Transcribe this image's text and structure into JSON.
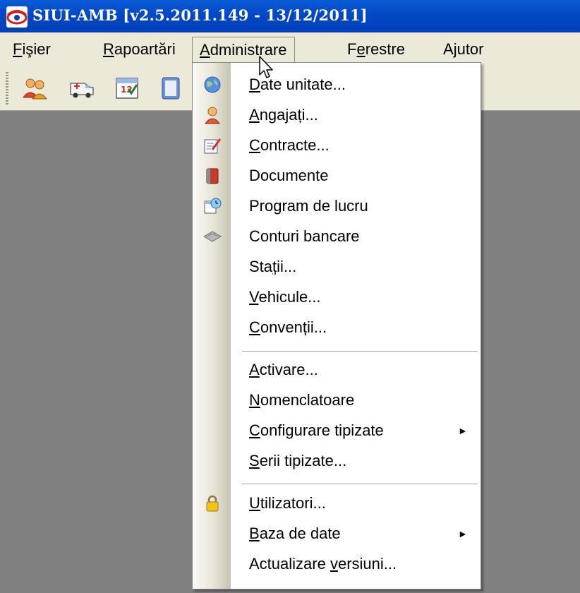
{
  "window": {
    "title": "SIUI-AMB [v2.5.2011.149 - 13/12/2011]",
    "colors": {
      "titlebar": "#0248c4",
      "workspace": "#808080",
      "menubar": "#ece9d8"
    }
  },
  "menubar": {
    "items": [
      {
        "pre": "",
        "key": "F",
        "post": "işier"
      },
      {
        "pre": "",
        "key": "R",
        "post": "apoartări"
      },
      {
        "pre": "",
        "key": "A",
        "post": "dministrare"
      },
      {
        "pre": "F",
        "key": "e",
        "post": "restre"
      },
      {
        "pre": "A",
        "key": "j",
        "post": "utor"
      }
    ]
  },
  "toolbar": {
    "buttons": [
      "users-icon",
      "ambulance-icon",
      "calendar-icon",
      "document-icon"
    ]
  },
  "dropdown": {
    "items": [
      {
        "pre": "",
        "key": "D",
        "post": "ate unitate...",
        "icon": "globe-icon"
      },
      {
        "pre": "",
        "key": "A",
        "post": "ngajați...",
        "icon": "person-icon"
      },
      {
        "pre": "",
        "key": "C",
        "post": "ontracte...",
        "icon": "contract-pen-icon"
      },
      {
        "pre": "Documente",
        "key": "",
        "post": "",
        "icon": "book-icon"
      },
      {
        "pre": "Program de lucru",
        "key": "",
        "post": "",
        "icon": "schedule-icon"
      },
      {
        "pre": "Conturi bancare",
        "key": "",
        "post": "",
        "icon": "card-icon"
      },
      {
        "pre": "Sta",
        "key": "ț",
        "post": "ii...",
        "icon": ""
      },
      {
        "pre": "",
        "key": "V",
        "post": "ehicule...",
        "icon": ""
      },
      {
        "pre": "",
        "key": "C",
        "post": "onvenții...",
        "icon": ""
      },
      {
        "pre": "",
        "key": "A",
        "post": "ctivare...",
        "icon": ""
      },
      {
        "pre": "",
        "key": "N",
        "post": "omenclatoare",
        "icon": ""
      },
      {
        "pre": "",
        "key": "C",
        "post": "onfigurare tipizate",
        "icon": "",
        "submenu": true
      },
      {
        "pre": "",
        "key": "S",
        "post": "erii tipizate...",
        "icon": ""
      },
      {
        "pre": "",
        "key": "U",
        "post": "tilizatori...",
        "icon": "lock-icon"
      },
      {
        "pre": "",
        "key": "B",
        "post": "aza de date",
        "icon": "",
        "submenu": true
      },
      {
        "pre": "Actualizare ",
        "key": "v",
        "post": "ersiuni...",
        "icon": ""
      }
    ],
    "submenu_glyph": "►"
  }
}
